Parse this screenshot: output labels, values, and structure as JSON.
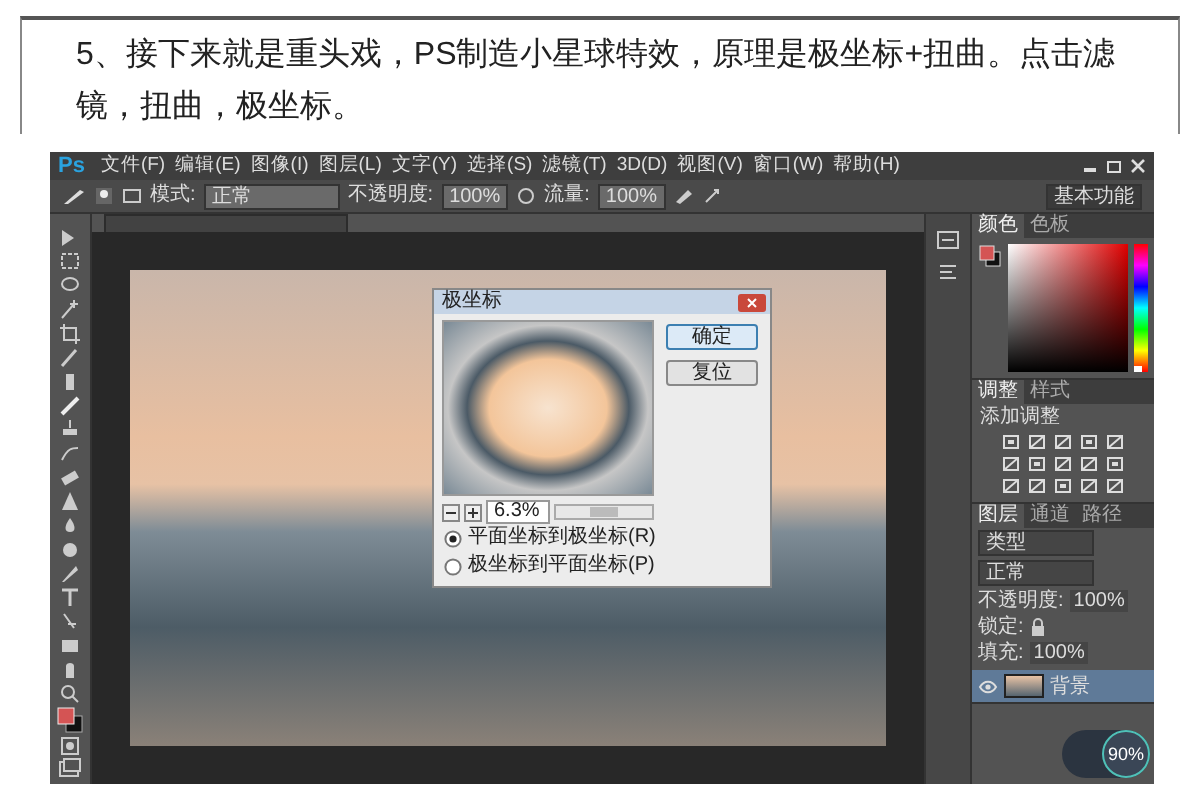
{
  "article": {
    "text": "5、接下来就是重头戏，PS制造小星球特效，原理是极坐标+扭曲。点击滤镜，扭曲，极坐标。"
  },
  "app": {
    "logo": "Ps",
    "menu": [
      "文件(F)",
      "编辑(E)",
      "图像(I)",
      "图层(L)",
      "文字(Y)",
      "选择(S)",
      "滤镜(T)",
      "3D(D)",
      "视图(V)",
      "窗口(W)",
      "帮助(H)"
    ],
    "options": {
      "mode_label": "模式:",
      "mode": "正常",
      "opacity_label": "不透明度:",
      "opacity": "100%",
      "flow_label": "流量:",
      "flow": "100%",
      "workspace": "基本功能"
    }
  },
  "dialog": {
    "title": "极坐标",
    "buttons": [
      {
        "label": "确定",
        "default": true
      },
      {
        "label": "复位",
        "default": false
      }
    ],
    "zoom": "6.3%",
    "options": [
      {
        "label": "平面坐标到极坐标(R)",
        "selected": true
      },
      {
        "label": "极坐标到平面坐标(P)",
        "selected": false
      }
    ]
  },
  "color_panel": {
    "tabs": [
      {
        "label": "颜色",
        "selected": true
      },
      {
        "label": "色板",
        "selected": false
      }
    ],
    "hue_slider": {
      "level": 0
    }
  },
  "adjust_panel": {
    "tabs": [
      {
        "label": "调整",
        "selected": true
      },
      {
        "label": "样式",
        "selected": false
      }
    ],
    "heading": "添加调整"
  },
  "layers_panel": {
    "tabs": [
      {
        "label": "图层",
        "selected": true
      },
      {
        "label": "通道",
        "selected": false
      },
      {
        "label": "路径",
        "selected": false
      }
    ],
    "filter": "类型",
    "blend": "正常",
    "opacity_label": "不透明度:",
    "opacity": "100%",
    "lock_label": "锁定:",
    "fill_label": "填充:",
    "fill": "100%",
    "layers": [
      {
        "name": "背景",
        "visible": true,
        "selected": true
      }
    ]
  },
  "speed_badge": {
    "value": "90%"
  }
}
